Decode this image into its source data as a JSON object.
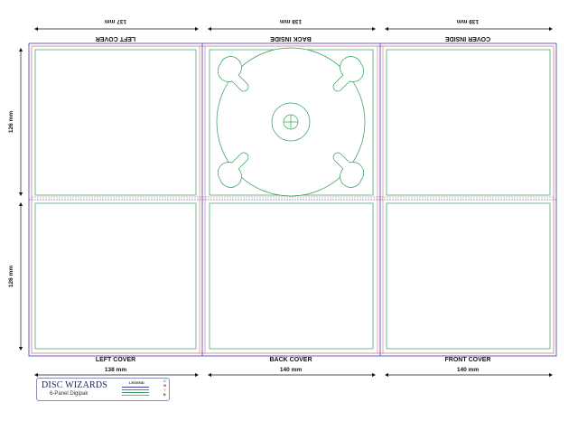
{
  "panels": {
    "top_left": "LEFT COVER",
    "top_middle": "BACK INSIDE",
    "top_right": "COVER INSIDE",
    "bottom_left": "LEFT COVER",
    "bottom_middle": "BACK COVER",
    "bottom_right": "FRONT COVER"
  },
  "dimensions": {
    "top_left": "137 mm",
    "top_middle": "138 mm",
    "top_right": "139 mm",
    "bottom_left": "138 mm",
    "bottom_middle": "140 mm",
    "bottom_right": "140 mm",
    "height_top": "126 mm",
    "height_bottom": "126 mm"
  },
  "logo": {
    "title": "DISC WIZARDS",
    "subtitle": "6-Panel Digipak",
    "legend_title": "LEGEND",
    "cmyk": [
      "C",
      "M",
      "Y",
      "K"
    ]
  },
  "colors": {
    "trim": "#3b3fa8",
    "bleed": "#d04a6a",
    "safe": "#2e9e5a",
    "dimension": "#111111"
  }
}
